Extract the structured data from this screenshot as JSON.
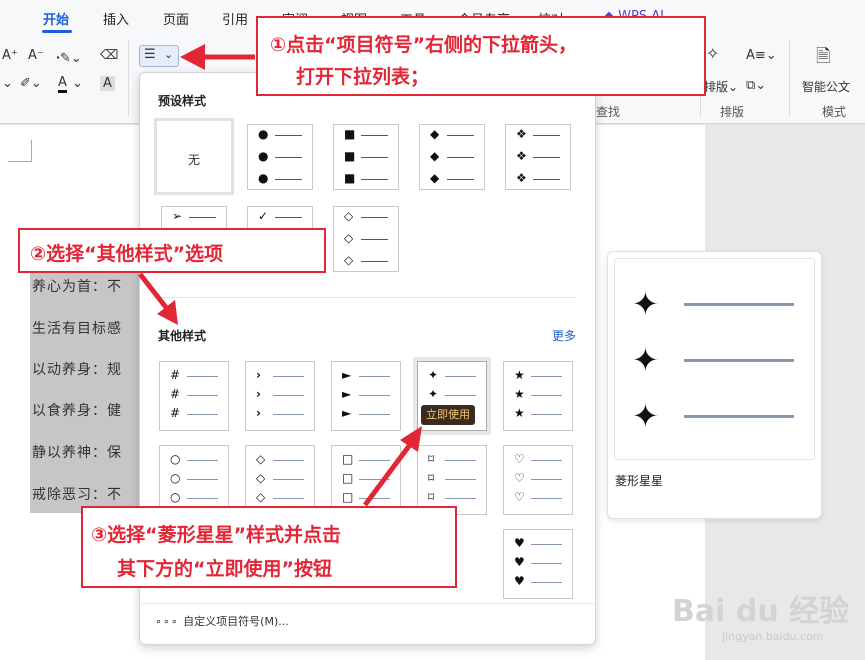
{
  "ribbon": {
    "tabs": [
      "开始",
      "插入",
      "页面",
      "引用",
      "审阅",
      "视图",
      "工具",
      "会员专享",
      "校对",
      "WPS AI"
    ],
    "group_labels": [
      "查找",
      "排版",
      "模式"
    ],
    "tool_labels": {
      "layout": "排版",
      "smart_doc": "智能公文"
    }
  },
  "document": {
    "lines": [
      "养心为首：不",
      "生活有目标感",
      "以动养身：规",
      "以食养身：健",
      "静以养神：保",
      "戒除恶习：不"
    ]
  },
  "dropdown": {
    "preset_title": "预设样式",
    "none_label": "无",
    "other_title": "其他样式",
    "more_label": "更多",
    "tooltip": "立即使用",
    "custom_label": "自定义项目符号(M)...",
    "preset_symbols": [
      "●",
      "■",
      "◆",
      "❖",
      "➢",
      "✓",
      "◇"
    ],
    "other_symbols": [
      "#",
      "›",
      "►",
      "✦",
      "★",
      "○",
      "◇",
      "□",
      "⌑",
      "♡",
      "♥"
    ]
  },
  "preview": {
    "name": "菱形星星",
    "symbol": "✦"
  },
  "annotations": {
    "step1": {
      "line1": "①点击“项目符号”右侧的下拉箭头，",
      "line2": "打开下拉列表；"
    },
    "step2": {
      "line1": "②选择“其他样式”选项"
    },
    "step3": {
      "line1": "③选择“菱形星星”样式并点击",
      "line2": "其下方的“立即使用”按钮"
    }
  },
  "watermark": {
    "logo": "Bai du 经验",
    "url": "jingyan.baidu.com"
  },
  "colors": {
    "accent": "#1a5fd8",
    "annotation": "#e32636",
    "tooltip_bg": "#3b2a20",
    "tooltip_text": "#f3c76d"
  }
}
